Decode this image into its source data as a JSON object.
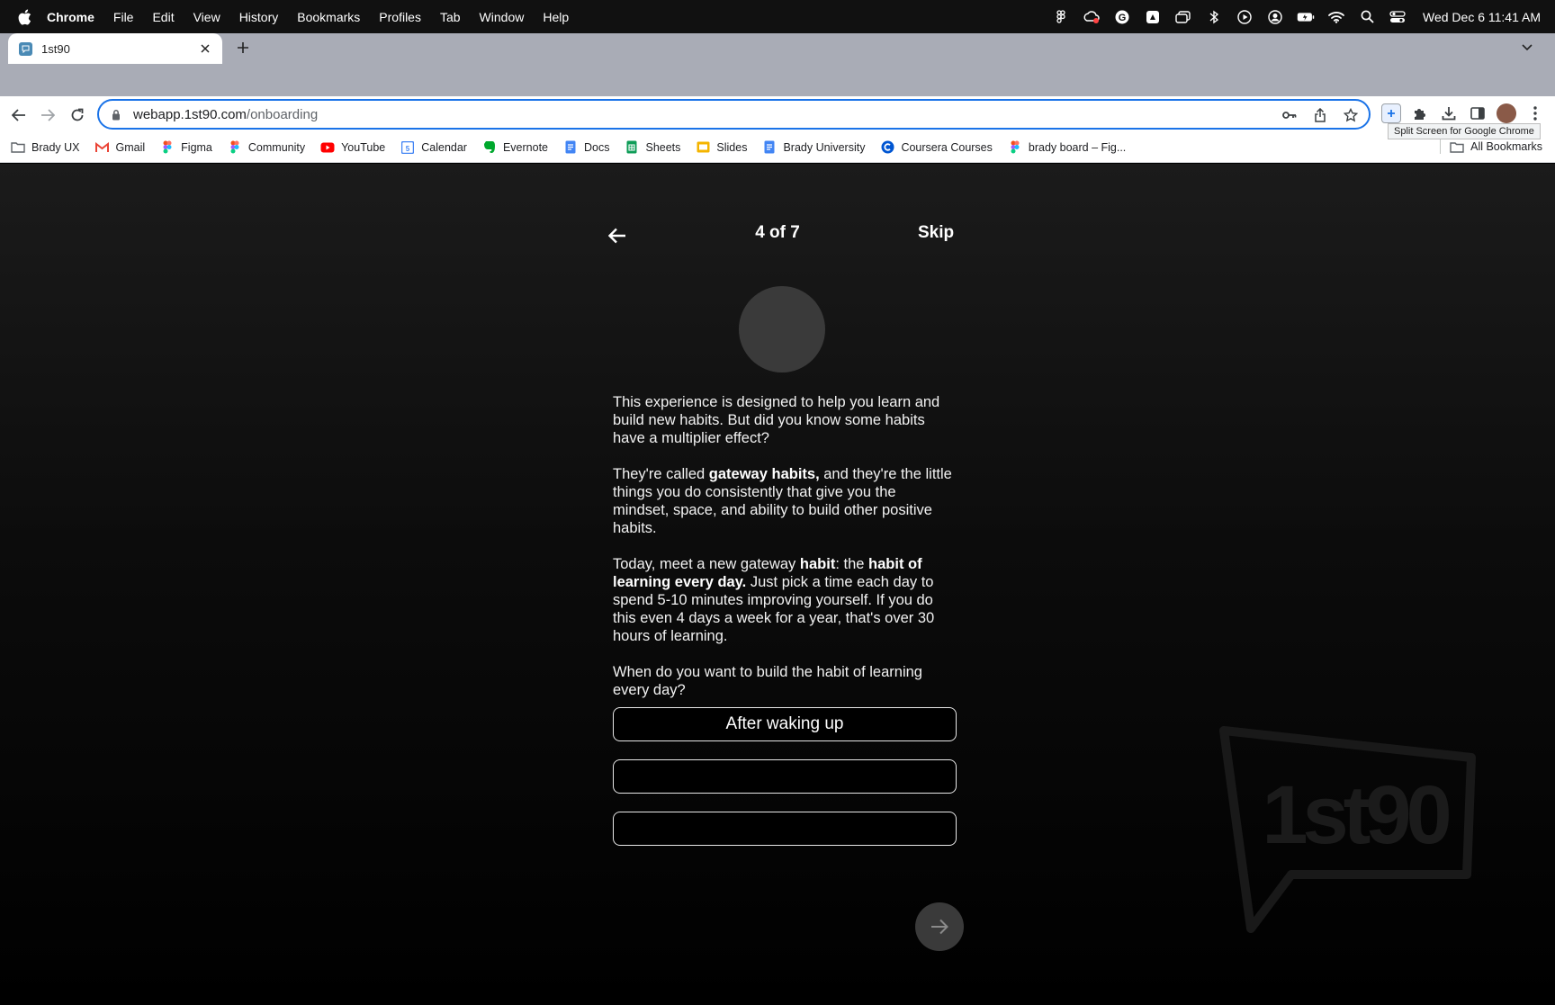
{
  "menubar": {
    "app_name": "Chrome",
    "items": [
      "File",
      "Edit",
      "View",
      "History",
      "Bookmarks",
      "Profiles",
      "Tab",
      "Window",
      "Help"
    ],
    "clock": "Wed Dec 6  11:41 AM"
  },
  "browser": {
    "tab_title": "1st90",
    "url_host": "webapp.1st90.com",
    "url_path": "/onboarding",
    "tooltip": "Split Screen for Google Chrome"
  },
  "bookmarks": {
    "items": [
      {
        "label": "Brady UX",
        "icon": "folder-icon",
        "color": "#5f6368"
      },
      {
        "label": "Gmail",
        "icon": "gmail-icon",
        "color": "#ea4335"
      },
      {
        "label": "Figma",
        "icon": "figma-icon",
        "color": "#f24e1e"
      },
      {
        "label": "Community",
        "icon": "figma-icon",
        "color": "#a259ff"
      },
      {
        "label": "YouTube",
        "icon": "youtube-icon",
        "color": "#ff0000"
      },
      {
        "label": "Calendar",
        "icon": "calendar-icon",
        "color": "#4285f4"
      },
      {
        "label": "Evernote",
        "icon": "evernote-icon",
        "color": "#00a82d"
      },
      {
        "label": "Docs",
        "icon": "docs-icon",
        "color": "#4285f4"
      },
      {
        "label": "Sheets",
        "icon": "sheets-icon",
        "color": "#0f9d58"
      },
      {
        "label": "Slides",
        "icon": "slides-icon",
        "color": "#f4b400"
      },
      {
        "label": "Brady University",
        "icon": "docs-icon",
        "color": "#4285f4"
      },
      {
        "label": "Coursera Courses",
        "icon": "coursera-icon",
        "color": "#0056d2"
      },
      {
        "label": "brady board – Fig...",
        "icon": "figma-icon",
        "color": "#f24e1e"
      }
    ],
    "all_label": "All Bookmarks"
  },
  "onboarding": {
    "step": "4 of 7",
    "skip": "Skip",
    "p1": "This experience is designed to help you learn and build new habits. But did you know some habits have a multiplier effect?",
    "p2_pre": "They're called ",
    "p2_bold": "gateway habits,",
    "p2_post": " and they're the little things you do consistently that give you the mindset, space, and ability to build other positive habits.",
    "p3_pre": "Today, meet a new gateway ",
    "p3_bold1": "habit",
    "p3_mid": ": the ",
    "p3_bold2": "habit of learning every day.",
    "p3_post": " Just pick a time each day to spend 5-10 minutes improving yourself. If you do this even 4 days a week for a year, that's over 30 hours of learning.",
    "question": "When do you want to build the habit of learning every day?",
    "options": [
      "After waking up",
      "",
      ""
    ],
    "watermark_text": "1st90"
  },
  "colors": {
    "accent": "#1a73e8",
    "option_border": "#e8e8e8",
    "button_bg": "#3a3a3a"
  }
}
